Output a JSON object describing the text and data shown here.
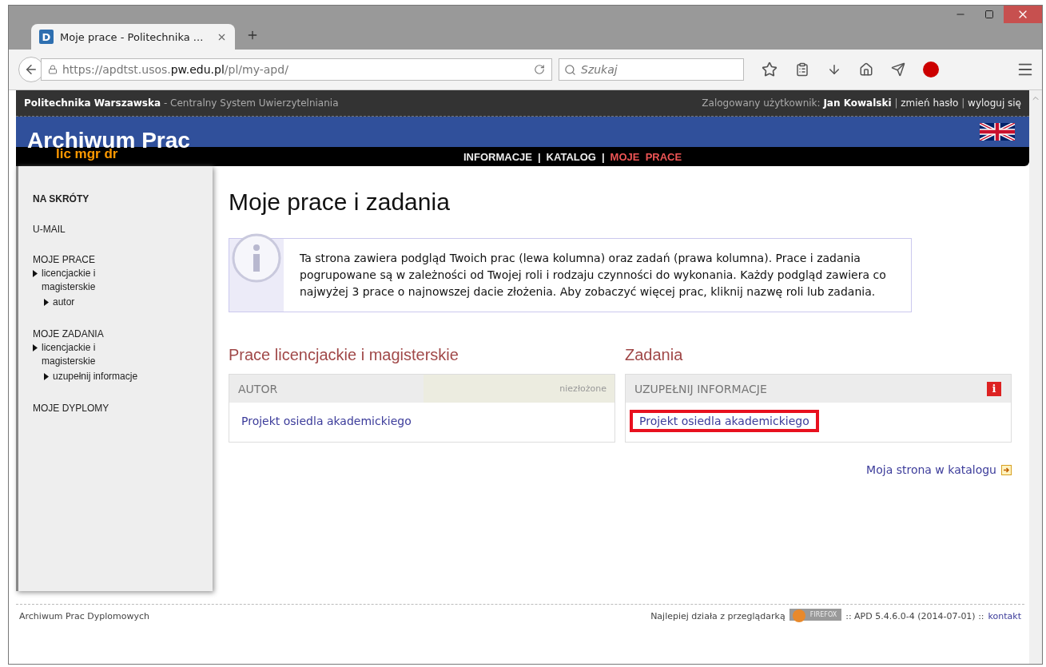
{
  "browser": {
    "tab_title": "Moje prace - Politechnika ...",
    "favicon": "D",
    "address": {
      "scheme": "https://apdtst.usos.",
      "host": "pw.edu.pl",
      "path": "/pl/my-apd/"
    },
    "search": {
      "placeholder": "Szukaj"
    }
  },
  "header": {
    "org": "Politechnika Warszawska",
    "subtitle": "- Centralny System Uwierzytelniania",
    "user_label": "Zalogowany użytkownik:",
    "user": "Jan Kowalski",
    "links": [
      "zmień hasło",
      "wyloguj się"
    ],
    "separator": "|"
  },
  "banner": {
    "title": "Archiwum Prac",
    "subtitle": "lic mgr dr",
    "separator": "|",
    "nav": [
      {
        "label": "INFORMACJE",
        "selected": false
      },
      {
        "label": "KATALOG",
        "selected": false
      },
      {
        "label": "MOJE  PRACE",
        "selected": true
      }
    ]
  },
  "sidebar": [
    {
      "title": "NA SKRÓTY",
      "kind": "heading"
    },
    {
      "title": "U-MAIL",
      "kind": "link"
    },
    {
      "title": "MOJE PRACE",
      "kind": "link",
      "children": [
        {
          "label": "licencjackie i magisterskie",
          "children": [
            {
              "label": "autor"
            }
          ]
        }
      ]
    },
    {
      "title": "MOJE ZADANIA",
      "kind": "link",
      "children": [
        {
          "label": "licencjackie i magisterskie",
          "children": [
            {
              "label": "uzupełnij informacje"
            }
          ]
        }
      ]
    },
    {
      "title": "MOJE DYPLOMY",
      "kind": "link"
    }
  ],
  "main": {
    "title": "Moje prace i zadania",
    "info": "Ta strona zawiera podgląd Twoich prac (lewa kolumna) oraz zadań (prawa kolumna). Prace i zadania pogrupowane są w zależności od Twojej roli i rodzaju czynności do wykonania. Każdy podgląd zawiera co najwyżej 3 prace o najnowszej dacie złożenia. Aby zobaczyć więcej prac, kliknij nazwę roli lub zadania.",
    "panels": [
      {
        "title": "Prace licencjackie i magisterskie",
        "header": "AUTOR",
        "status": "niezłożone",
        "items": [
          {
            "label": "Projekt osiedla akademickiego",
            "highlighted": false
          }
        ]
      },
      {
        "title": "Zadania",
        "header": "UZUPEŁNIJ INFORMACJE",
        "badge": "i",
        "items": [
          {
            "label": "Projekt osiedla akademickiego",
            "highlighted": true
          }
        ]
      }
    ],
    "catalog_link": "Moja strona w katalogu"
  },
  "footer": {
    "left": "Archiwum Prac Dyplomowych",
    "best_with": "Najlepiej działa z przeglądarką",
    "browser_badge": "FIREFOX",
    "version": ":: APD 5.4.6.0-4 (2014-07-01) ::",
    "contact": "kontakt"
  }
}
